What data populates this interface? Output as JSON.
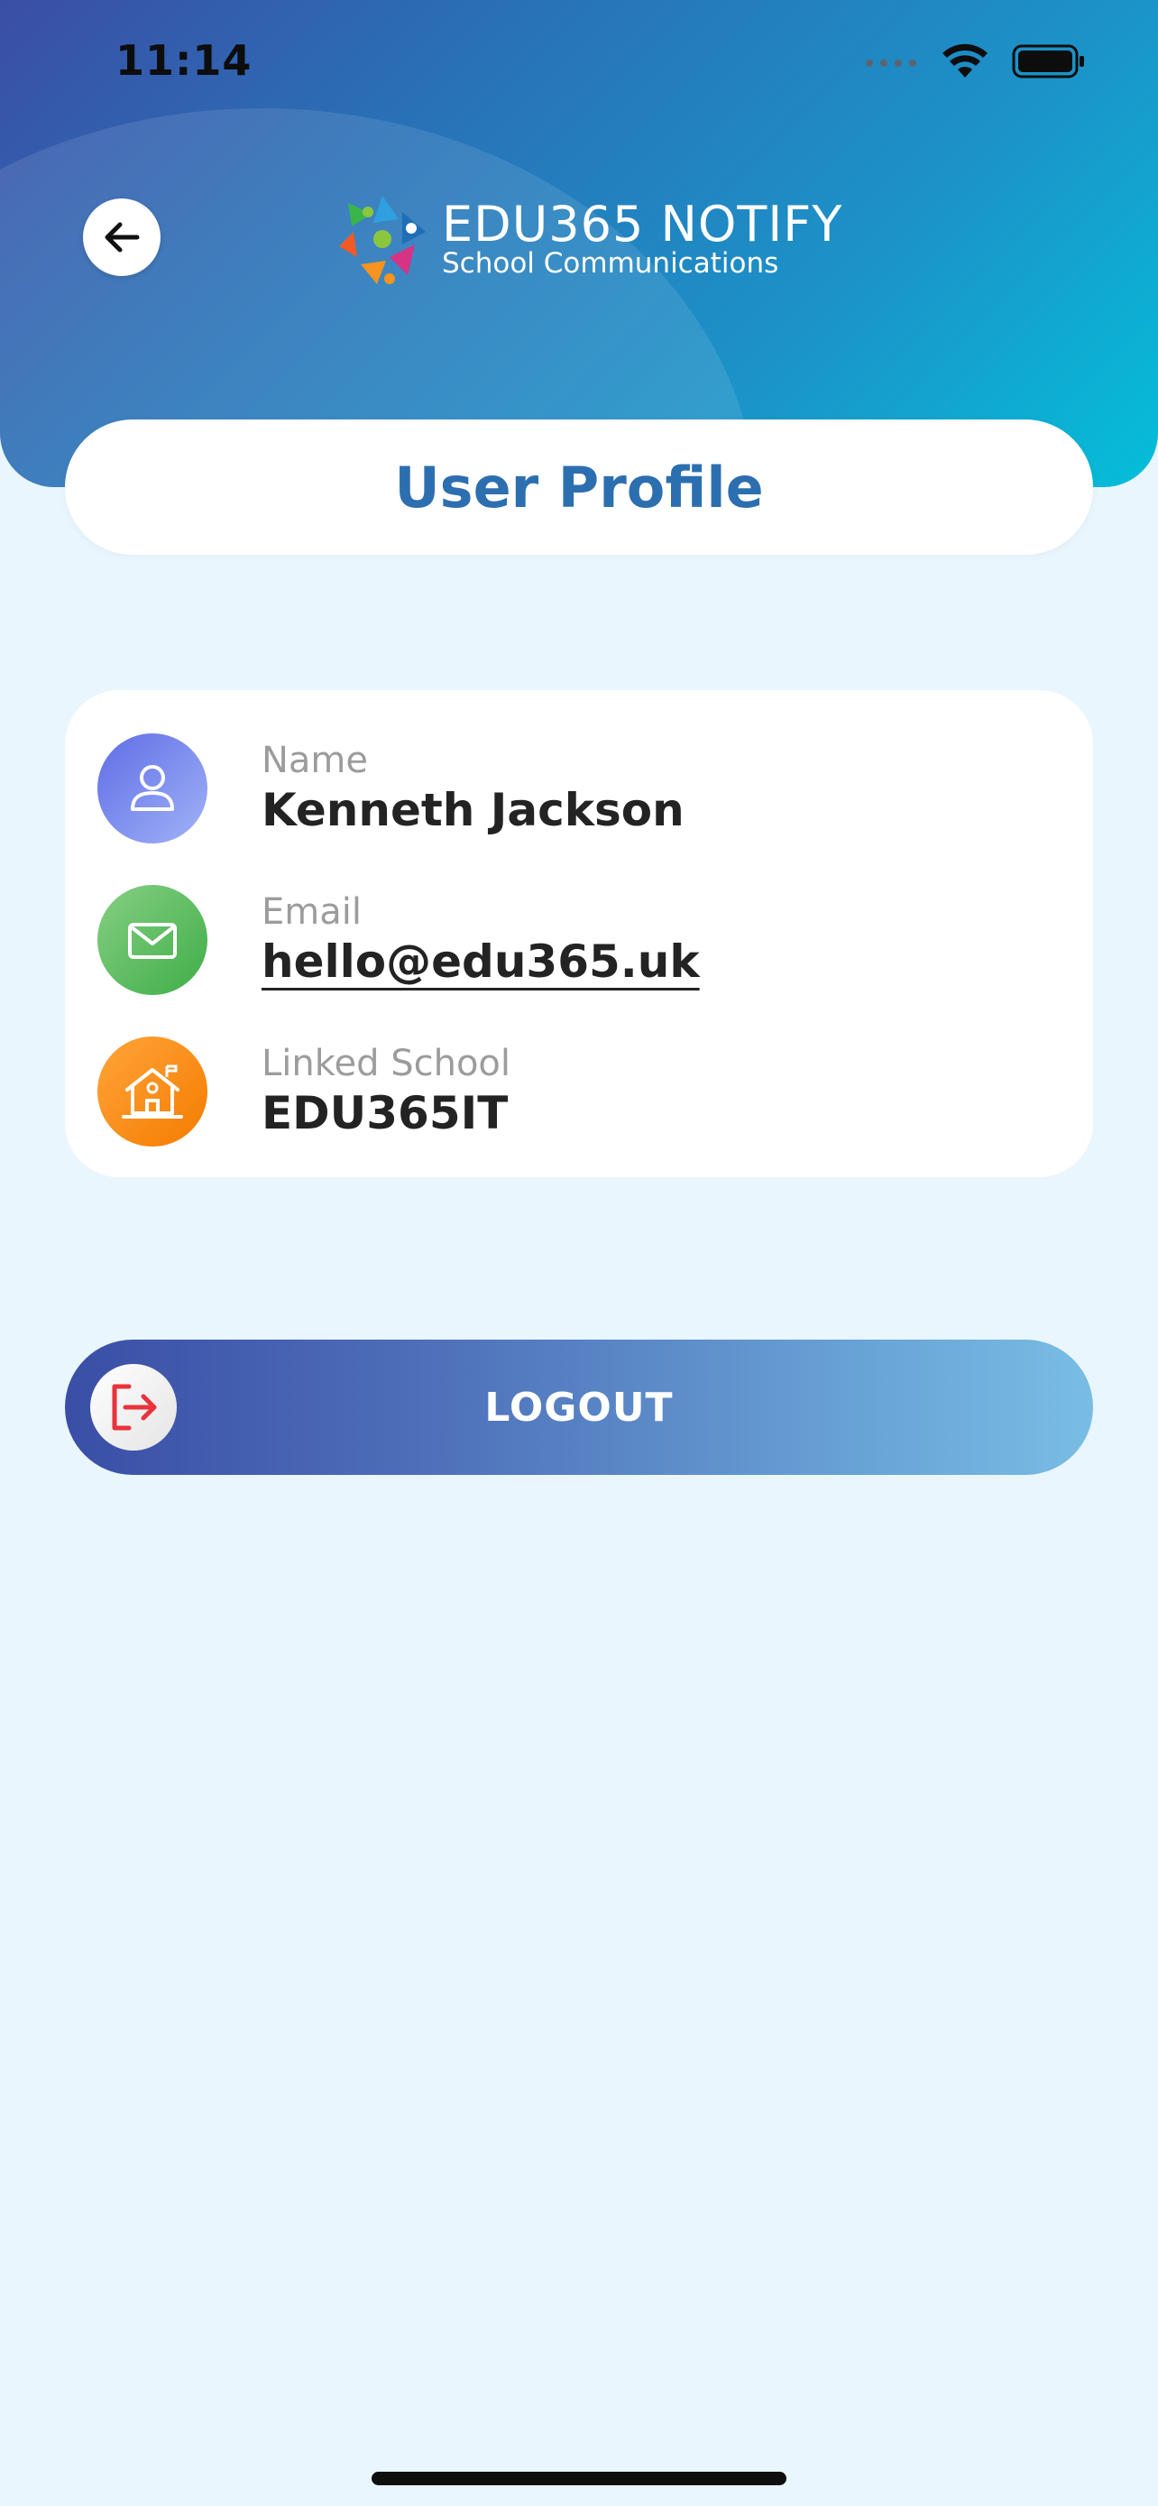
{
  "status_bar": {
    "time": "11:14"
  },
  "header": {
    "logo": {
      "title": "EDU365 NOTIFY",
      "subtitle": "School Communications"
    },
    "back_icon": "arrow-left-icon",
    "gradient_colors": [
      "#3b4ea6",
      "#1b94c9",
      "#04bfd9"
    ]
  },
  "page": {
    "title": "User Profile",
    "title_color": "#2c6fb0",
    "background": "#eaf6fd"
  },
  "profile": {
    "name": {
      "label": "Name",
      "value": "Kenneth Jackson",
      "icon": "user-icon",
      "icon_color": "#6a79ee"
    },
    "email": {
      "label": "Email",
      "value": "hello@edu365.uk",
      "icon": "mail-icon",
      "icon_color": "#4caf50"
    },
    "school": {
      "label": "Linked School",
      "value": "EDU365IT",
      "icon": "school-icon",
      "icon_color": "#f7931e"
    }
  },
  "logout": {
    "label": "LOGOUT",
    "icon": "logout-icon",
    "icon_color": "#e8333b"
  }
}
